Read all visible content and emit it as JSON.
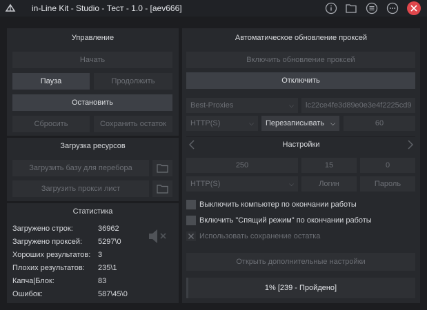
{
  "window": {
    "title": "in-Line Kit - Studio - Тест - 1.0 - [aev666]"
  },
  "control": {
    "title": "Управление",
    "start": "Начать",
    "pause": "Пауза",
    "resume": "Продолжить",
    "stop": "Остановить",
    "reset": "Сбросить",
    "save_rest": "Сохранить остаток"
  },
  "resources": {
    "title": "Загрузка ресурсов",
    "load_base": "Загрузить базу для перебора",
    "load_proxy": "Загрузить прокси лист"
  },
  "stats": {
    "title": "Статистика",
    "rows": [
      {
        "label": "Загружено строк:",
        "value": "36962"
      },
      {
        "label": "Загружено проксей:",
        "value": "5297\\0"
      },
      {
        "label": "Хороших результатов:",
        "value": "3"
      },
      {
        "label": "Плохих результатов:",
        "value": "235\\1"
      },
      {
        "label": "Капча|Блок:",
        "value": "83"
      },
      {
        "label": "Ошибок:",
        "value": "587\\45\\0"
      }
    ]
  },
  "proxy_update": {
    "title": "Автоматическое обновление проксей",
    "enable": "Включить обновление проксей",
    "disable": "Отключить",
    "source": "Best-Proxies",
    "key": "lc22ce4fe3d89e0e3e4f2225cd9",
    "type": "HTTP(S)",
    "mode": "Перезаписывать",
    "interval": "60"
  },
  "settings": {
    "title": "Настройки",
    "threads": "250",
    "timeout": "15",
    "retries": "0",
    "proxy_type": "HTTP(S)",
    "login_placeholder": "Логин",
    "password_placeholder": "Пароль"
  },
  "options": {
    "shutdown": "Выключить компьютер по окончании работы",
    "sleep": "Включить \"Спящий режим\" по окончании работы",
    "use_save": "Использовать сохранение остатка"
  },
  "extra_settings": "Открыть дополнительные настройки",
  "progress": {
    "text": "1% [239 - Пройдено]",
    "fraction": 0.01
  },
  "icons": {
    "app": "app-logo-icon",
    "info": "info-icon",
    "folder": "folder-icon",
    "menu": "menu-icon",
    "more": "more-icon",
    "close": "close-icon",
    "sound": "sound-muted-icon"
  }
}
